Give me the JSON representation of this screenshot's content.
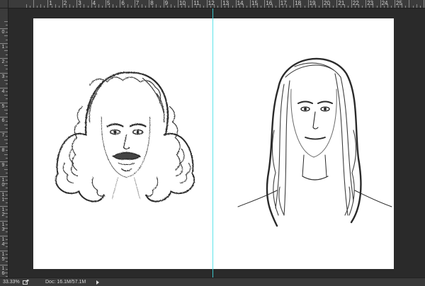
{
  "ruler": {
    "top_labels": [
      "1",
      "2",
      "3",
      "4",
      "5",
      "6",
      "7",
      "8",
      "9",
      "10",
      "11",
      "12",
      "13",
      "14",
      "15",
      "16",
      "17",
      "18",
      "19",
      "20",
      "21",
      "22",
      "23",
      "24",
      "25"
    ],
    "left_labels": [
      "0",
      "1",
      "2",
      "3",
      "4",
      "5",
      "6",
      "7",
      "8",
      "9",
      "10",
      "11",
      "12",
      "13",
      "14",
      "15",
      "16"
    ]
  },
  "status": {
    "zoom": "33.33%",
    "doc": "Doc: 16.1M/57.1M"
  },
  "colors": {
    "guide": "#3fe0e6",
    "canvas": "#ffffff",
    "pasteboard": "#2a2a2a"
  }
}
